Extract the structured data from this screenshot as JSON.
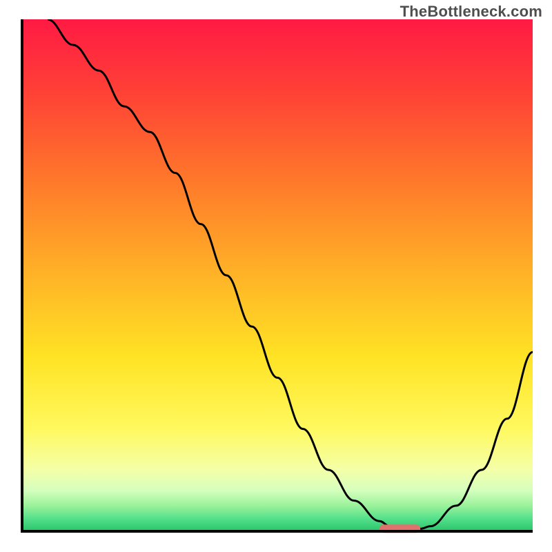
{
  "watermark": "TheBottleneck.com",
  "chart_data": {
    "type": "line",
    "title": "",
    "xlabel": "",
    "ylabel": "",
    "xlim": [
      0,
      100
    ],
    "ylim": [
      0,
      100
    ],
    "x": [
      5,
      10,
      15,
      20,
      25,
      30,
      35,
      40,
      45,
      50,
      55,
      60,
      65,
      70,
      72,
      75,
      78,
      80,
      85,
      90,
      95,
      100
    ],
    "y": [
      100,
      95,
      90,
      83,
      78,
      70,
      60,
      50,
      40,
      30,
      20,
      12,
      6,
      2,
      1,
      0.5,
      0.5,
      1,
      5,
      12,
      22,
      35
    ],
    "marker": {
      "x_start": 70,
      "x_end": 78,
      "y": 0.5
    },
    "background_bands": [
      {
        "from": 100,
        "to": 35,
        "gradient": [
          "#ff1a44",
          "#ff6a2a"
        ]
      },
      {
        "from": 35,
        "to": 12,
        "gradient": [
          "#ffa728",
          "#ffe824"
        ]
      },
      {
        "from": 12,
        "to": 5,
        "gradient": [
          "#fff95f",
          "#f8ffb8"
        ]
      },
      {
        "from": 5,
        "to": 2,
        "gradient": [
          "#d7ffc0",
          "#a8f7a4"
        ]
      },
      {
        "from": 2,
        "to": 0,
        "gradient": [
          "#55e08b",
          "#28c46b"
        ]
      }
    ],
    "axes": {
      "color": "#000000",
      "width": 4
    },
    "curve": {
      "color": "#000000",
      "width": 3
    },
    "marker_style": {
      "fill": "#e0726e",
      "rx": 6,
      "height": 12
    }
  }
}
